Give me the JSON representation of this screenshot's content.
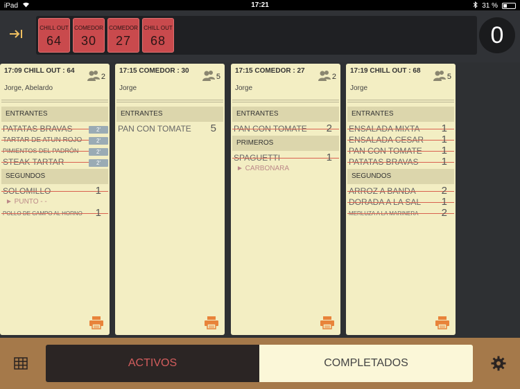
{
  "status_bar": {
    "device": "iPad",
    "time": "17:21",
    "battery": "31 %"
  },
  "header": {
    "ticket_chips": [
      {
        "label": "CHILL OUT",
        "number": "64"
      },
      {
        "label": "COMEDOR",
        "number": "30"
      },
      {
        "label": "COMEDOR",
        "number": "27"
      },
      {
        "label": "CHILL OUT",
        "number": "68"
      }
    ],
    "counter": "0"
  },
  "cards": [
    {
      "title": "17:09  CHILL OUT : 64",
      "waiter": "Jorge, Abelardo",
      "guests": "2",
      "sections": [
        {
          "name": "ENTRANTES",
          "items": [
            {
              "name": "PATATAS BRAVAS",
              "tag": "2'"
            },
            {
              "name": "TARTAR DE ATUN ROJO",
              "tag": "2'"
            },
            {
              "name": "PIMIENTOS DEL PADRÓN",
              "tag": "2'"
            },
            {
              "name": "STEAK TARTAR",
              "tag": "2'"
            }
          ]
        },
        {
          "name": "SEGUNDOS",
          "items": [
            {
              "name": "SOLOMILLO",
              "qty": "1",
              "modifier": "► PUNTO - -"
            },
            {
              "name": "POLLO DE CAMPO AL HORNO",
              "qty": "1"
            }
          ]
        }
      ]
    },
    {
      "title": "17:15  COMEDOR : 30",
      "waiter": "Jorge",
      "guests": "5",
      "sections": [
        {
          "name": "ENTRANTES",
          "items": [
            {
              "name": "PAN CON TOMATE",
              "qty": "5"
            }
          ]
        }
      ]
    },
    {
      "title": "17:15  COMEDOR : 27",
      "waiter": "Jorge",
      "guests": "2",
      "sections": [
        {
          "name": "ENTRANTES",
          "items": [
            {
              "name": "PAN CON TOMATE",
              "qty": "2"
            }
          ]
        },
        {
          "name": "PRIMEROS",
          "items": [
            {
              "name": "SPAGUETTI",
              "qty": "1",
              "modifier": "► CARBONARA"
            }
          ]
        }
      ]
    },
    {
      "title": "17:19  CHILL OUT : 68",
      "waiter": "Jorge",
      "guests": "5",
      "sections": [
        {
          "name": "ENTRANTES",
          "items": [
            {
              "name": "ENSALADA MIXTA",
              "qty": "1"
            },
            {
              "name": "ENSALADA CESAR",
              "qty": "1"
            },
            {
              "name": "PAN CON TOMATE",
              "qty": "1"
            },
            {
              "name": "PATATAS BRAVAS",
              "qty": "1"
            }
          ]
        },
        {
          "name": "SEGUNDOS",
          "items": [
            {
              "name": "ARROZ A BANDA",
              "qty": "2"
            },
            {
              "name": "DORADA A LA SAL",
              "qty": "1"
            },
            {
              "name": "MERLUZA A LA MARINERA",
              "qty": "2"
            }
          ]
        }
      ]
    }
  ],
  "bottom": {
    "tab_active": "ACTIVOS",
    "tab_completed": "COMPLETADOS"
  },
  "colors": {
    "accent_red": "#c94a4d",
    "card_bg": "#f3eec3",
    "bottom_bar": "#a5794a",
    "print_icon": "#e8833a"
  },
  "icons": {
    "collapse": "collapse-panel-icon",
    "guests": "guests-icon",
    "print": "printer-icon",
    "grid": "grid-icon",
    "settings": "gear-icon"
  }
}
